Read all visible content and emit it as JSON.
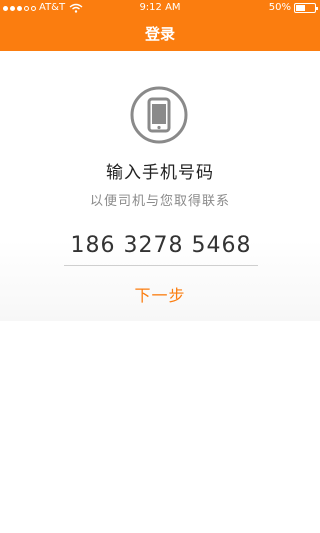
{
  "status_bar": {
    "carrier": "AT&T",
    "time": "9:12 AM",
    "battery_percent": "50%",
    "battery_level": 0.5
  },
  "header": {
    "title": "登录"
  },
  "main": {
    "heading": "输入手机号码",
    "subheading": "以便司机与您取得联系",
    "phone_value": "186 3278 5468",
    "next_label": "下一步"
  },
  "colors": {
    "accent": "#fb7d0f",
    "icon_gray": "#8a8a8a"
  },
  "icons": {
    "main": "smartphone-icon",
    "wifi": "wifi-icon"
  }
}
